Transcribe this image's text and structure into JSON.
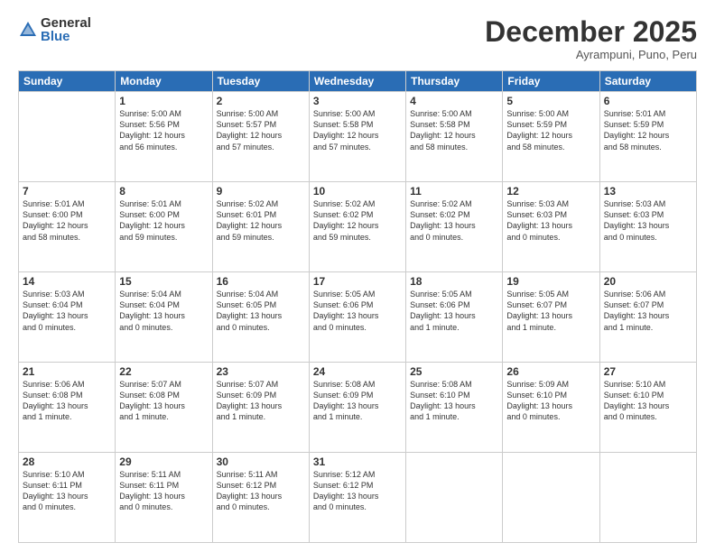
{
  "logo": {
    "general": "General",
    "blue": "Blue"
  },
  "header": {
    "month": "December 2025",
    "location": "Ayrampuni, Puno, Peru"
  },
  "weekdays": [
    "Sunday",
    "Monday",
    "Tuesday",
    "Wednesday",
    "Thursday",
    "Friday",
    "Saturday"
  ],
  "weeks": [
    [
      {
        "day": "",
        "info": ""
      },
      {
        "day": "1",
        "info": "Sunrise: 5:00 AM\nSunset: 5:56 PM\nDaylight: 12 hours\nand 56 minutes."
      },
      {
        "day": "2",
        "info": "Sunrise: 5:00 AM\nSunset: 5:57 PM\nDaylight: 12 hours\nand 57 minutes."
      },
      {
        "day": "3",
        "info": "Sunrise: 5:00 AM\nSunset: 5:58 PM\nDaylight: 12 hours\nand 57 minutes."
      },
      {
        "day": "4",
        "info": "Sunrise: 5:00 AM\nSunset: 5:58 PM\nDaylight: 12 hours\nand 58 minutes."
      },
      {
        "day": "5",
        "info": "Sunrise: 5:00 AM\nSunset: 5:59 PM\nDaylight: 12 hours\nand 58 minutes."
      },
      {
        "day": "6",
        "info": "Sunrise: 5:01 AM\nSunset: 5:59 PM\nDaylight: 12 hours\nand 58 minutes."
      }
    ],
    [
      {
        "day": "7",
        "info": "Sunrise: 5:01 AM\nSunset: 6:00 PM\nDaylight: 12 hours\nand 58 minutes."
      },
      {
        "day": "8",
        "info": "Sunrise: 5:01 AM\nSunset: 6:00 PM\nDaylight: 12 hours\nand 59 minutes."
      },
      {
        "day": "9",
        "info": "Sunrise: 5:02 AM\nSunset: 6:01 PM\nDaylight: 12 hours\nand 59 minutes."
      },
      {
        "day": "10",
        "info": "Sunrise: 5:02 AM\nSunset: 6:02 PM\nDaylight: 12 hours\nand 59 minutes."
      },
      {
        "day": "11",
        "info": "Sunrise: 5:02 AM\nSunset: 6:02 PM\nDaylight: 13 hours\nand 0 minutes."
      },
      {
        "day": "12",
        "info": "Sunrise: 5:03 AM\nSunset: 6:03 PM\nDaylight: 13 hours\nand 0 minutes."
      },
      {
        "day": "13",
        "info": "Sunrise: 5:03 AM\nSunset: 6:03 PM\nDaylight: 13 hours\nand 0 minutes."
      }
    ],
    [
      {
        "day": "14",
        "info": "Sunrise: 5:03 AM\nSunset: 6:04 PM\nDaylight: 13 hours\nand 0 minutes."
      },
      {
        "day": "15",
        "info": "Sunrise: 5:04 AM\nSunset: 6:04 PM\nDaylight: 13 hours\nand 0 minutes."
      },
      {
        "day": "16",
        "info": "Sunrise: 5:04 AM\nSunset: 6:05 PM\nDaylight: 13 hours\nand 0 minutes."
      },
      {
        "day": "17",
        "info": "Sunrise: 5:05 AM\nSunset: 6:06 PM\nDaylight: 13 hours\nand 0 minutes."
      },
      {
        "day": "18",
        "info": "Sunrise: 5:05 AM\nSunset: 6:06 PM\nDaylight: 13 hours\nand 1 minute."
      },
      {
        "day": "19",
        "info": "Sunrise: 5:05 AM\nSunset: 6:07 PM\nDaylight: 13 hours\nand 1 minute."
      },
      {
        "day": "20",
        "info": "Sunrise: 5:06 AM\nSunset: 6:07 PM\nDaylight: 13 hours\nand 1 minute."
      }
    ],
    [
      {
        "day": "21",
        "info": "Sunrise: 5:06 AM\nSunset: 6:08 PM\nDaylight: 13 hours\nand 1 minute."
      },
      {
        "day": "22",
        "info": "Sunrise: 5:07 AM\nSunset: 6:08 PM\nDaylight: 13 hours\nand 1 minute."
      },
      {
        "day": "23",
        "info": "Sunrise: 5:07 AM\nSunset: 6:09 PM\nDaylight: 13 hours\nand 1 minute."
      },
      {
        "day": "24",
        "info": "Sunrise: 5:08 AM\nSunset: 6:09 PM\nDaylight: 13 hours\nand 1 minute."
      },
      {
        "day": "25",
        "info": "Sunrise: 5:08 AM\nSunset: 6:10 PM\nDaylight: 13 hours\nand 1 minute."
      },
      {
        "day": "26",
        "info": "Sunrise: 5:09 AM\nSunset: 6:10 PM\nDaylight: 13 hours\nand 0 minutes."
      },
      {
        "day": "27",
        "info": "Sunrise: 5:10 AM\nSunset: 6:10 PM\nDaylight: 13 hours\nand 0 minutes."
      }
    ],
    [
      {
        "day": "28",
        "info": "Sunrise: 5:10 AM\nSunset: 6:11 PM\nDaylight: 13 hours\nand 0 minutes."
      },
      {
        "day": "29",
        "info": "Sunrise: 5:11 AM\nSunset: 6:11 PM\nDaylight: 13 hours\nand 0 minutes."
      },
      {
        "day": "30",
        "info": "Sunrise: 5:11 AM\nSunset: 6:12 PM\nDaylight: 13 hours\nand 0 minutes."
      },
      {
        "day": "31",
        "info": "Sunrise: 5:12 AM\nSunset: 6:12 PM\nDaylight: 13 hours\nand 0 minutes."
      },
      {
        "day": "",
        "info": ""
      },
      {
        "day": "",
        "info": ""
      },
      {
        "day": "",
        "info": ""
      }
    ]
  ]
}
